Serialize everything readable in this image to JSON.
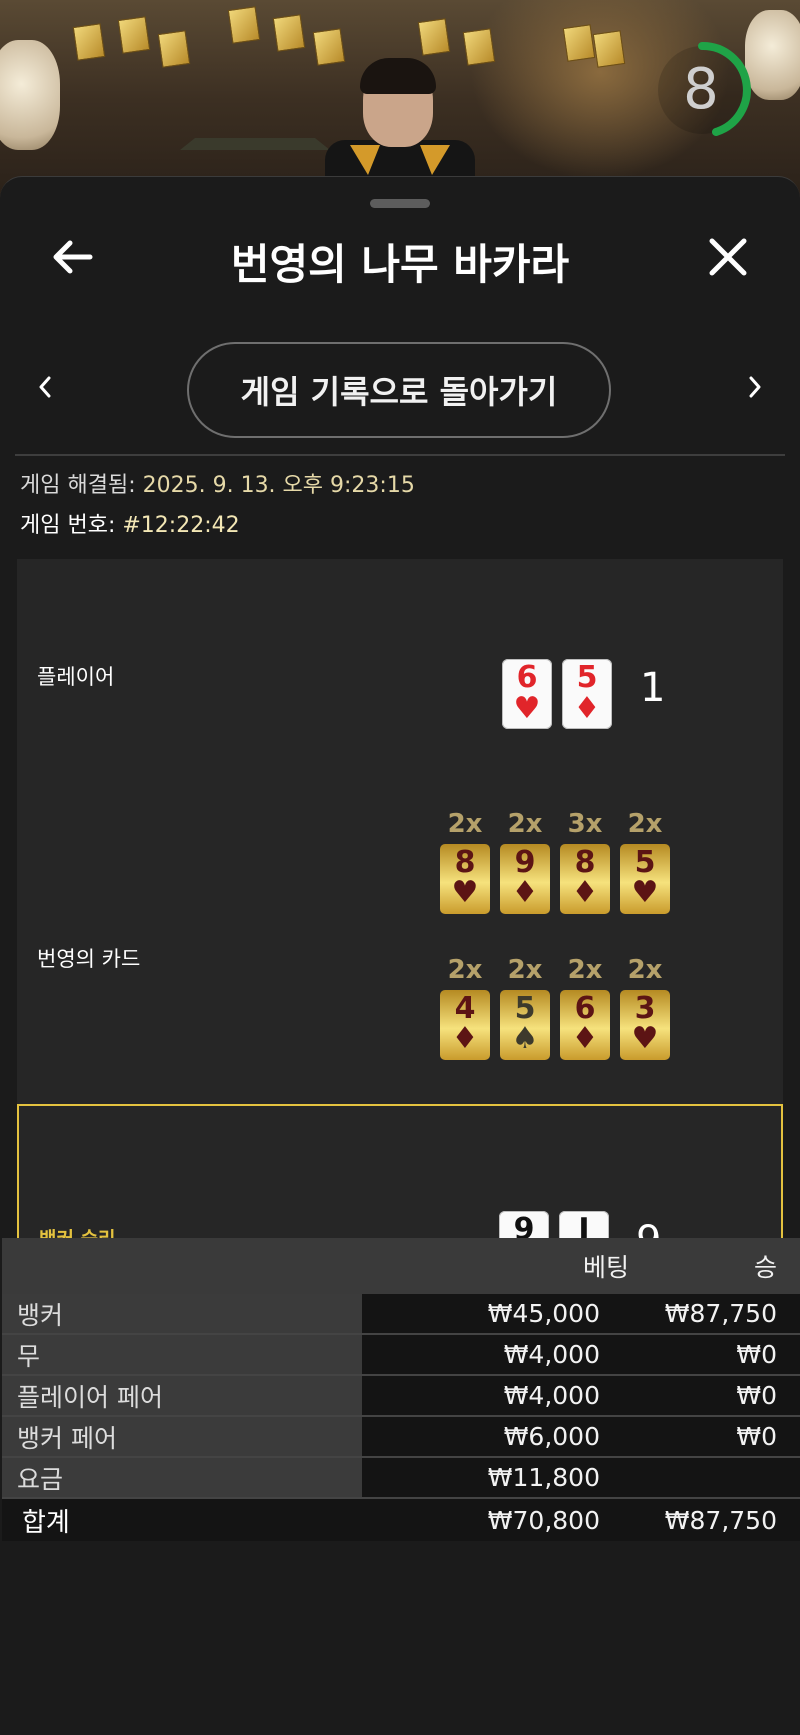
{
  "timer": {
    "value": "8"
  },
  "header": {
    "title": "번영의 나무 바카라",
    "back_icon": "arrow-left-icon",
    "close_icon": "close-icon"
  },
  "nav": {
    "back_to_history": "게임 기록으로 돌아가기",
    "prev_icon": "chevron-left-icon",
    "next_icon": "chevron-right-icon"
  },
  "meta": {
    "resolved_label": "게임 해결됨:",
    "resolved_value": "2025. 9. 13. 오후 9:23:15",
    "game_no_label": "게임 번호:",
    "game_no_value": "#12:22:42"
  },
  "player": {
    "label": "플레이어",
    "score": "1",
    "cards": [
      {
        "rank": "6",
        "suit": "♥",
        "color": "red"
      },
      {
        "rank": "5",
        "suit": "♦",
        "color": "red"
      }
    ]
  },
  "prosperity": {
    "label": "번영의 카드",
    "rows": [
      [
        {
          "mult": "2x",
          "rank": "8",
          "suit": "♥"
        },
        {
          "mult": "2x",
          "rank": "9",
          "suit": "♦"
        },
        {
          "mult": "3x",
          "rank": "8",
          "suit": "♦"
        },
        {
          "mult": "2x",
          "rank": "5",
          "suit": "♥"
        }
      ],
      [
        {
          "mult": "2x",
          "rank": "4",
          "suit": "♦"
        },
        {
          "mult": "2x",
          "rank": "5",
          "suit": "♠"
        },
        {
          "mult": "2x",
          "rank": "6",
          "suit": "♦"
        },
        {
          "mult": "2x",
          "rank": "3",
          "suit": "♥"
        }
      ]
    ]
  },
  "banker": {
    "label": "뱅커 승리",
    "label_color": "#e4c23f",
    "score": "9",
    "cards": [
      {
        "rank": "9",
        "suit": "♣",
        "color": "black"
      },
      {
        "rank": "J",
        "suit": "♣",
        "color": "black"
      }
    ]
  },
  "table": {
    "headers": {
      "bet": "베팅",
      "win": "승"
    },
    "rows": [
      {
        "label": "뱅커",
        "bet": "₩45,000",
        "win": "₩87,750"
      },
      {
        "label": "무",
        "bet": "₩4,000",
        "win": "₩0"
      },
      {
        "label": "플레이어 페어",
        "bet": "₩4,000",
        "win": "₩0"
      },
      {
        "label": "뱅커 페어",
        "bet": "₩6,000",
        "win": "₩0"
      },
      {
        "label": "요금",
        "bet": "₩11,800",
        "win": ""
      }
    ],
    "total": {
      "label": "합계",
      "bet": "₩70,800",
      "win": "₩87,750"
    }
  },
  "colors": {
    "accent_gold": "#e4c23f",
    "timer_green": "#1fa347",
    "sheet_bg": "#1b1b1b"
  }
}
